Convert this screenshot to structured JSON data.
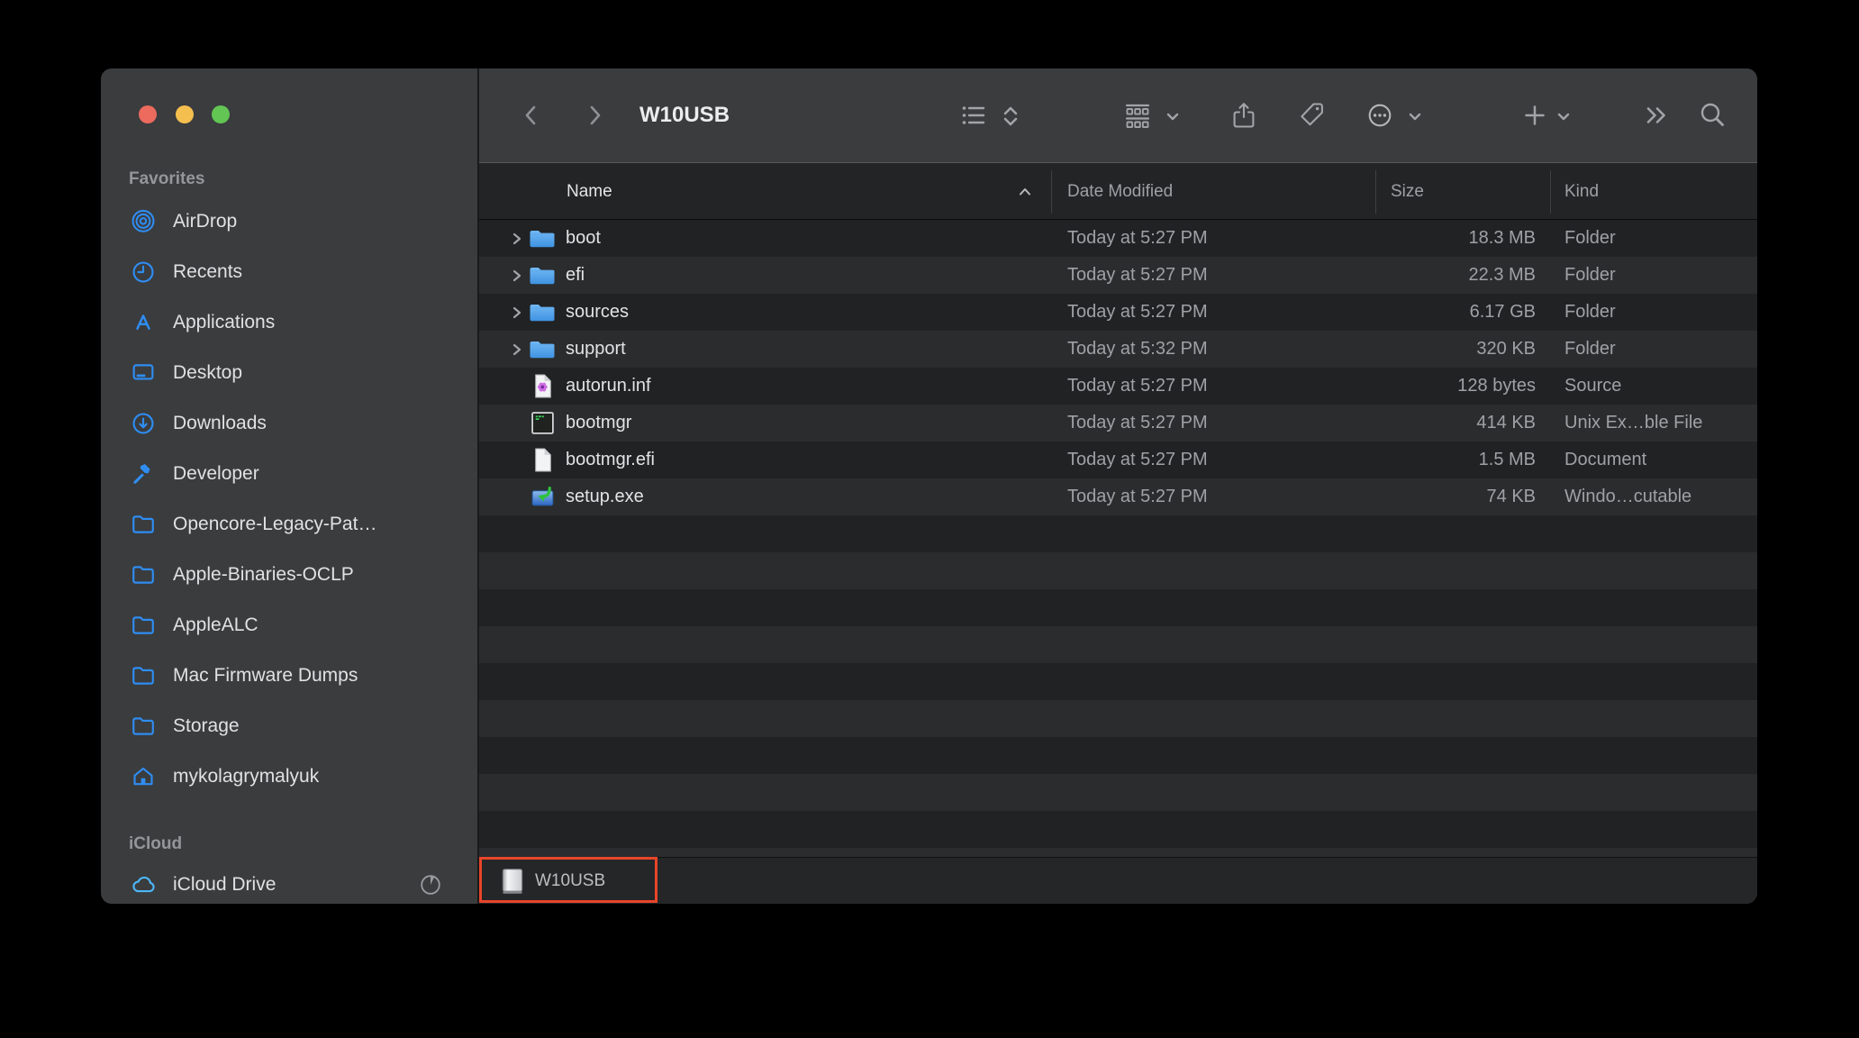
{
  "window": {
    "title": "W10USB"
  },
  "traffic_lights": {
    "close": "#ec6a5e",
    "minimize": "#f5bf4f",
    "zoom": "#62c554"
  },
  "toolbar": {
    "icons": [
      "back",
      "forward",
      "list-view",
      "sort-toggle",
      "group",
      "group-menu",
      "share",
      "tag",
      "more-actions",
      "more-menu",
      "new-item",
      "new-item-menu",
      "overflow",
      "search"
    ]
  },
  "sidebar": {
    "sections": [
      {
        "label": "Favorites",
        "items": [
          {
            "label": "AirDrop",
            "icon": "airdrop"
          },
          {
            "label": "Recents",
            "icon": "clock"
          },
          {
            "label": "Applications",
            "icon": "app-store"
          },
          {
            "label": "Desktop",
            "icon": "desktop"
          },
          {
            "label": "Downloads",
            "icon": "download-circle"
          },
          {
            "label": "Developer",
            "icon": "hammer"
          },
          {
            "label": "Opencore-Legacy-Pat…",
            "icon": "folder"
          },
          {
            "label": "Apple-Binaries-OCLP",
            "icon": "folder"
          },
          {
            "label": "AppleALC",
            "icon": "folder"
          },
          {
            "label": "Mac Firmware Dumps",
            "icon": "folder"
          },
          {
            "label": "Storage",
            "icon": "folder"
          },
          {
            "label": "mykolagrymalyuk",
            "icon": "home"
          }
        ]
      },
      {
        "label": "iCloud",
        "items": [
          {
            "label": "iCloud Drive",
            "icon": "icloud",
            "trailing_icon": "sync-pie"
          }
        ]
      }
    ]
  },
  "table": {
    "columns": [
      {
        "label": "Name",
        "sorted": true,
        "direction": "asc"
      },
      {
        "label": "Date Modified"
      },
      {
        "label": "Size"
      },
      {
        "label": "Kind"
      }
    ],
    "rows": [
      {
        "name": "boot",
        "icon": "folder-filled",
        "expandable": true,
        "date_modified": "Today at 5:27 PM",
        "size": "18.3 MB",
        "kind": "Folder"
      },
      {
        "name": "efi",
        "icon": "folder-filled",
        "expandable": true,
        "date_modified": "Today at 5:27 PM",
        "size": "22.3 MB",
        "kind": "Folder"
      },
      {
        "name": "sources",
        "icon": "folder-filled",
        "expandable": true,
        "date_modified": "Today at 5:27 PM",
        "size": "6.17 GB",
        "kind": "Folder"
      },
      {
        "name": "support",
        "icon": "folder-filled",
        "expandable": true,
        "date_modified": "Today at 5:32 PM",
        "size": "320 KB",
        "kind": "Folder"
      },
      {
        "name": "autorun.inf",
        "icon": "setup-info-file",
        "expandable": false,
        "date_modified": "Today at 5:27 PM",
        "size": "128 bytes",
        "kind": "Source"
      },
      {
        "name": "bootmgr",
        "icon": "unix-executable",
        "expandable": false,
        "date_modified": "Today at 5:27 PM",
        "size": "414 KB",
        "kind": "Unix Ex…ble File"
      },
      {
        "name": "bootmgr.efi",
        "icon": "document",
        "expandable": false,
        "date_modified": "Today at 5:27 PM",
        "size": "1.5 MB",
        "kind": "Document"
      },
      {
        "name": "setup.exe",
        "icon": "windows-executable",
        "expandable": false,
        "date_modified": "Today at 5:27 PM",
        "size": "74 KB",
        "kind": "Windo…cutable"
      }
    ]
  },
  "pathbar": {
    "volume": "W10USB",
    "icon": "drive"
  },
  "annotation": {
    "color": "#e8452a"
  },
  "colors": {
    "chrome": "#3a3c3e",
    "row_dark": "#202224",
    "row_light": "#2a2c2e",
    "accent_blue": "#2f8df2",
    "icloud_blue": "#4db6f5",
    "text_bright": "#e2e3e5",
    "text_muted": "#9fa1a4",
    "annotation_red": "#e8452a"
  }
}
